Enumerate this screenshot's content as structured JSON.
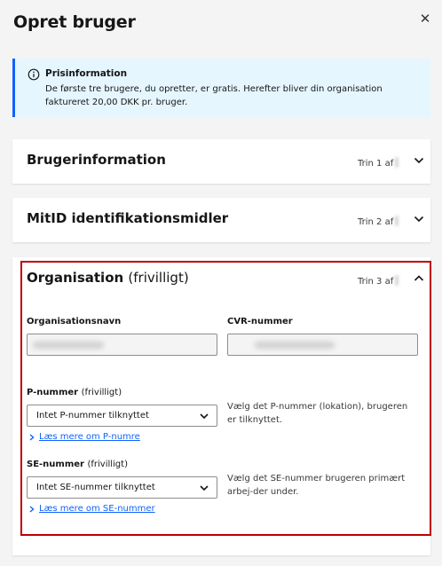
{
  "header": {
    "title": "Opret bruger",
    "close_glyph": "✕"
  },
  "info": {
    "icon": "info-icon",
    "title": "Prisinformation",
    "text": "De første tre brugere, du opretter, er gratis. Herefter bliver din organisation faktureret 20,00 DKK pr. bruger."
  },
  "sections": [
    {
      "title": "Brugerinformation",
      "step": "Trin 1 af",
      "expanded": false
    },
    {
      "title": "MitID identifikationsmidler",
      "step": "Trin 2 af",
      "expanded": false
    },
    {
      "title": "Organisation",
      "title_suffix": "(frivilligt)",
      "step": "Trin 3 af",
      "expanded": true
    }
  ],
  "organisation": {
    "name_label": "Organisationsnavn",
    "cvr_label": "CVR-nummer",
    "p_number": {
      "label": "P-nummer",
      "optional": "(frivilligt)",
      "value": "Intet P-nummer tilknyttet",
      "help": "Vælg det P-nummer (lokation), brugeren er tilknyttet.",
      "link": "Læs mere om P-numre"
    },
    "se_number": {
      "label": "SE-nummer",
      "optional": "(frivilligt)",
      "value": "Intet SE-nummer tilknyttet",
      "help": "Vælg det SE-nummer brugeren primært arbej-der under.",
      "link": "Læs mere om SE-nummer"
    }
  },
  "colors": {
    "accent": "#0f62fe",
    "info_bg": "#e5f6ff",
    "highlight": "#c00000",
    "background": "#f4f4f4"
  }
}
